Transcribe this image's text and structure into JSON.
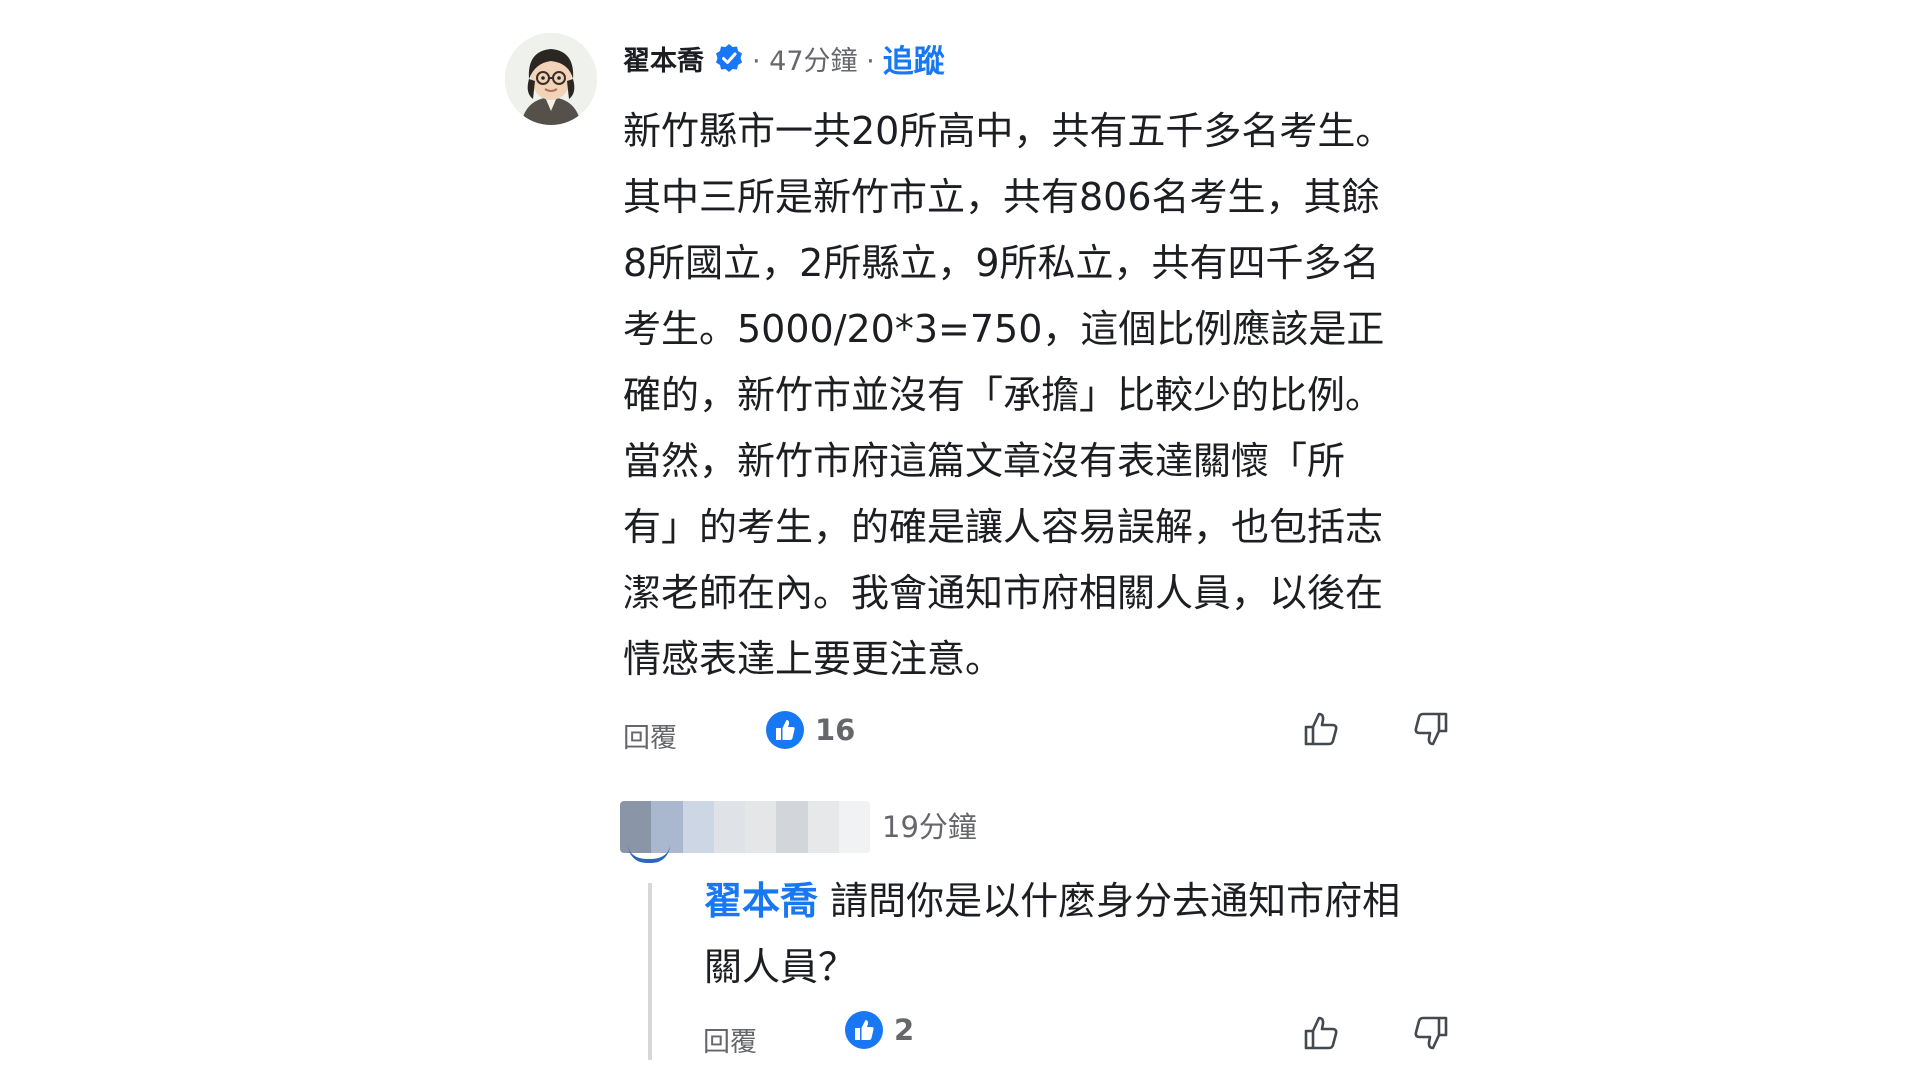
{
  "comment": {
    "author": "翟本喬",
    "verified_icon": "verified-badge-icon",
    "time": "· 47分鐘 ·",
    "follow_label": "追蹤",
    "body_lines": [
      "新竹縣市一共20所高中，共有五千多名考生。",
      "其中三所是新竹市立，共有806名考生，其餘",
      "8所國立，2所縣立，9所私立，共有四千多名",
      "考生。5000/20*3=750，這個比例應該是正",
      "確的，新竹市並沒有「承擔」比較少的比例。",
      "當然，新竹市府這篇文章沒有表達關懷「所",
      "有」的考生，的確是讓人容易誤解，也包括志",
      "潔老師在內。我會通知市府相關人員，以後在",
      "情感表達上要更注意。"
    ],
    "reply_label": "回覆",
    "like_count": "16"
  },
  "reply": {
    "author": "[blurred]",
    "time": "19分鐘",
    "mention": "翟本喬",
    "text_line1": " 請問你是以什麼身分去通知市府相",
    "text_line2": "關人員？",
    "reply_label": "回覆",
    "like_count": "2"
  },
  "colors": {
    "accent": "#1877f2",
    "meta_text": "#65676b",
    "body_text": "#1c1e21"
  }
}
